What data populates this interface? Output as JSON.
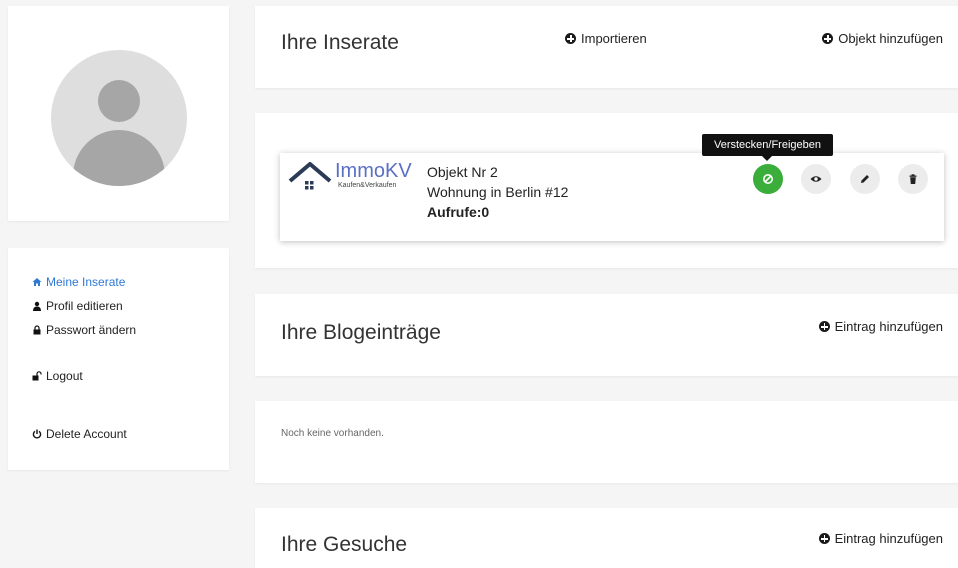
{
  "sidebar": {
    "items": [
      {
        "label": "Meine Inserate",
        "icon": "home-icon"
      },
      {
        "label": "Profil editieren",
        "icon": "user-icon"
      },
      {
        "label": "Passwort ändern",
        "icon": "lock-icon"
      },
      {
        "label": "Logout",
        "icon": "unlock-icon"
      },
      {
        "label": "Delete Account",
        "icon": "power-icon"
      }
    ]
  },
  "inserate": {
    "title": "Ihre Inserate",
    "import_label": "Importieren",
    "add_label": "Objekt hinzufügen"
  },
  "listing": {
    "logo_text": "ImmoKV",
    "logo_sub": "Kaufen&Verkaufen",
    "name": "Objekt Nr 2",
    "description": "Wohnung in Berlin #12",
    "views": "Aufrufe:0",
    "tooltip": "Verstecken/Freigeben"
  },
  "blog": {
    "title": "Ihre Blogeinträge",
    "add_label": "Eintrag hinzufügen",
    "empty": "Noch keine vorhanden."
  },
  "gesuche": {
    "title": "Ihre Gesuche",
    "add_label": "Eintrag hinzufügen"
  },
  "colors": {
    "accent": "#2f79d2",
    "toggle_green": "#3aad3a",
    "logo_blue": "#5a6fc6"
  }
}
